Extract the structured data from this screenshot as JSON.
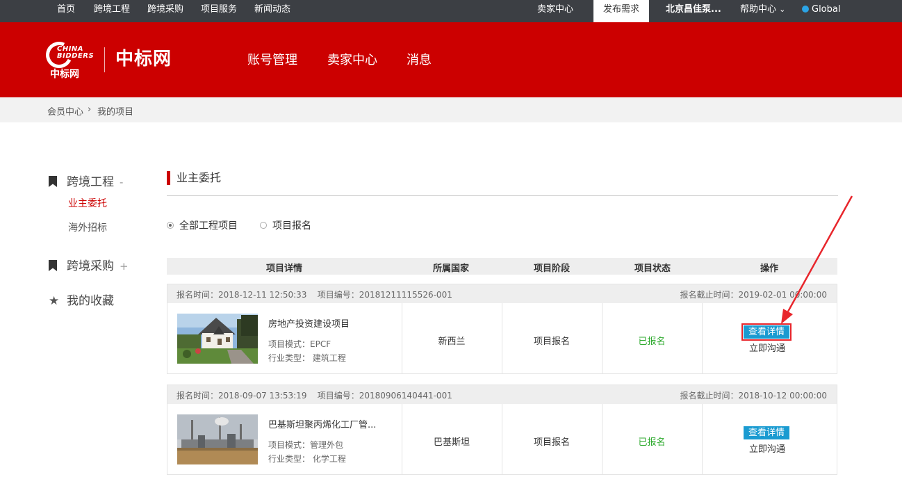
{
  "topbar": {
    "left_items": [
      "首页",
      "跨境工程",
      "跨境采购",
      "项目服务",
      "新闻动态"
    ],
    "seller_center": "卖家中心",
    "publish": "发布需求",
    "company": "北京昌佳泵...",
    "help": "帮助中心",
    "help_arrow": "⌄",
    "global": "Global"
  },
  "header": {
    "logo_en": "CHINA\nBIDDERS",
    "logo_cn": "中标网",
    "site_name": "中标网",
    "nav": [
      "账号管理",
      "卖家中心",
      "消息"
    ]
  },
  "breadcrumb": {
    "items": [
      "会员中心",
      "我的项目"
    ],
    "separator": "›"
  },
  "sidebar": {
    "groups": [
      {
        "label": "跨境工程",
        "toggle": "-",
        "icon": "bookmark-icon"
      },
      {
        "label": "跨境采购",
        "toggle": "+",
        "icon": "bookmark-icon"
      },
      {
        "label": "我的收藏",
        "toggle": "",
        "icon": "star-icon"
      }
    ],
    "sub_items": [
      "业主委托",
      "海外招标"
    ]
  },
  "main": {
    "section_title": "业主委托",
    "filters": [
      {
        "label": "全部工程项目",
        "selected": true
      },
      {
        "label": "项目报名",
        "selected": false
      }
    ],
    "columns": [
      "项目详情",
      "所属国家",
      "项目阶段",
      "项目状态",
      "操作"
    ]
  },
  "projects": [
    {
      "signup_time": "报名时间：2018-12-11 12:50:33",
      "project_no": "项目编号：20181211115526-001",
      "deadline": "报名截止时间：2019-02-01 00:00:00",
      "name": "房地产投资建设项目",
      "mode": "项目模式：EPCF",
      "industry": "行业类型：  建筑工程",
      "country": "新西兰",
      "stage": "项目报名",
      "status": "已报名",
      "detail_btn": "查看详情",
      "chat_btn": "立即沟通",
      "image": "house-photo"
    },
    {
      "signup_time": "报名时间：2018-09-07 13:53:19",
      "project_no": "项目编号：20180906140441-001",
      "deadline": "报名截止时间：2018-10-12 00:00:00",
      "name": "巴基斯坦聚丙烯化工厂管...",
      "mode": "项目模式：管理外包",
      "industry": "行业类型：  化学工程",
      "country": "巴基斯坦",
      "stage": "项目报名",
      "status": "已报名",
      "detail_btn": "查看详情",
      "chat_btn": "立即沟通",
      "image": "factory-photo"
    }
  ],
  "colors": {
    "brand_red": "#cc0000",
    "topbar": "#3c3f44",
    "detail_blue": "#1a9bd1",
    "status_green": "#2eaa2e",
    "annotation_red": "#e8262c"
  }
}
